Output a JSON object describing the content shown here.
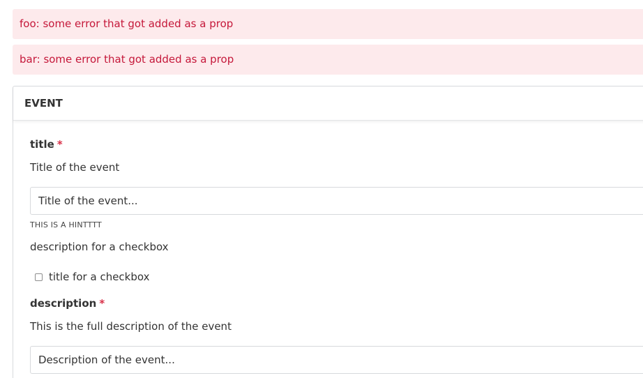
{
  "alerts": [
    {
      "text": "foo: some error that got added as a prop"
    },
    {
      "text": "bar: some error that got added as a prop"
    }
  ],
  "panel": {
    "title": "EVENT",
    "fields": {
      "title": {
        "label": "title",
        "required_mark": "*",
        "description": "Title of the event",
        "placeholder": "Title of the event...",
        "hint": "THIS IS A HINTTTT"
      },
      "checkbox": {
        "description": "description for a checkbox",
        "label": "title for a checkbox",
        "checked": false
      },
      "description": {
        "label": "description",
        "required_mark": "*",
        "description": "This is the full description of the event",
        "placeholder": "Description of the event..."
      }
    }
  },
  "colors": {
    "alert_bg": "#fdeaec",
    "alert_text": "#c5183a",
    "required": "#d83048"
  }
}
